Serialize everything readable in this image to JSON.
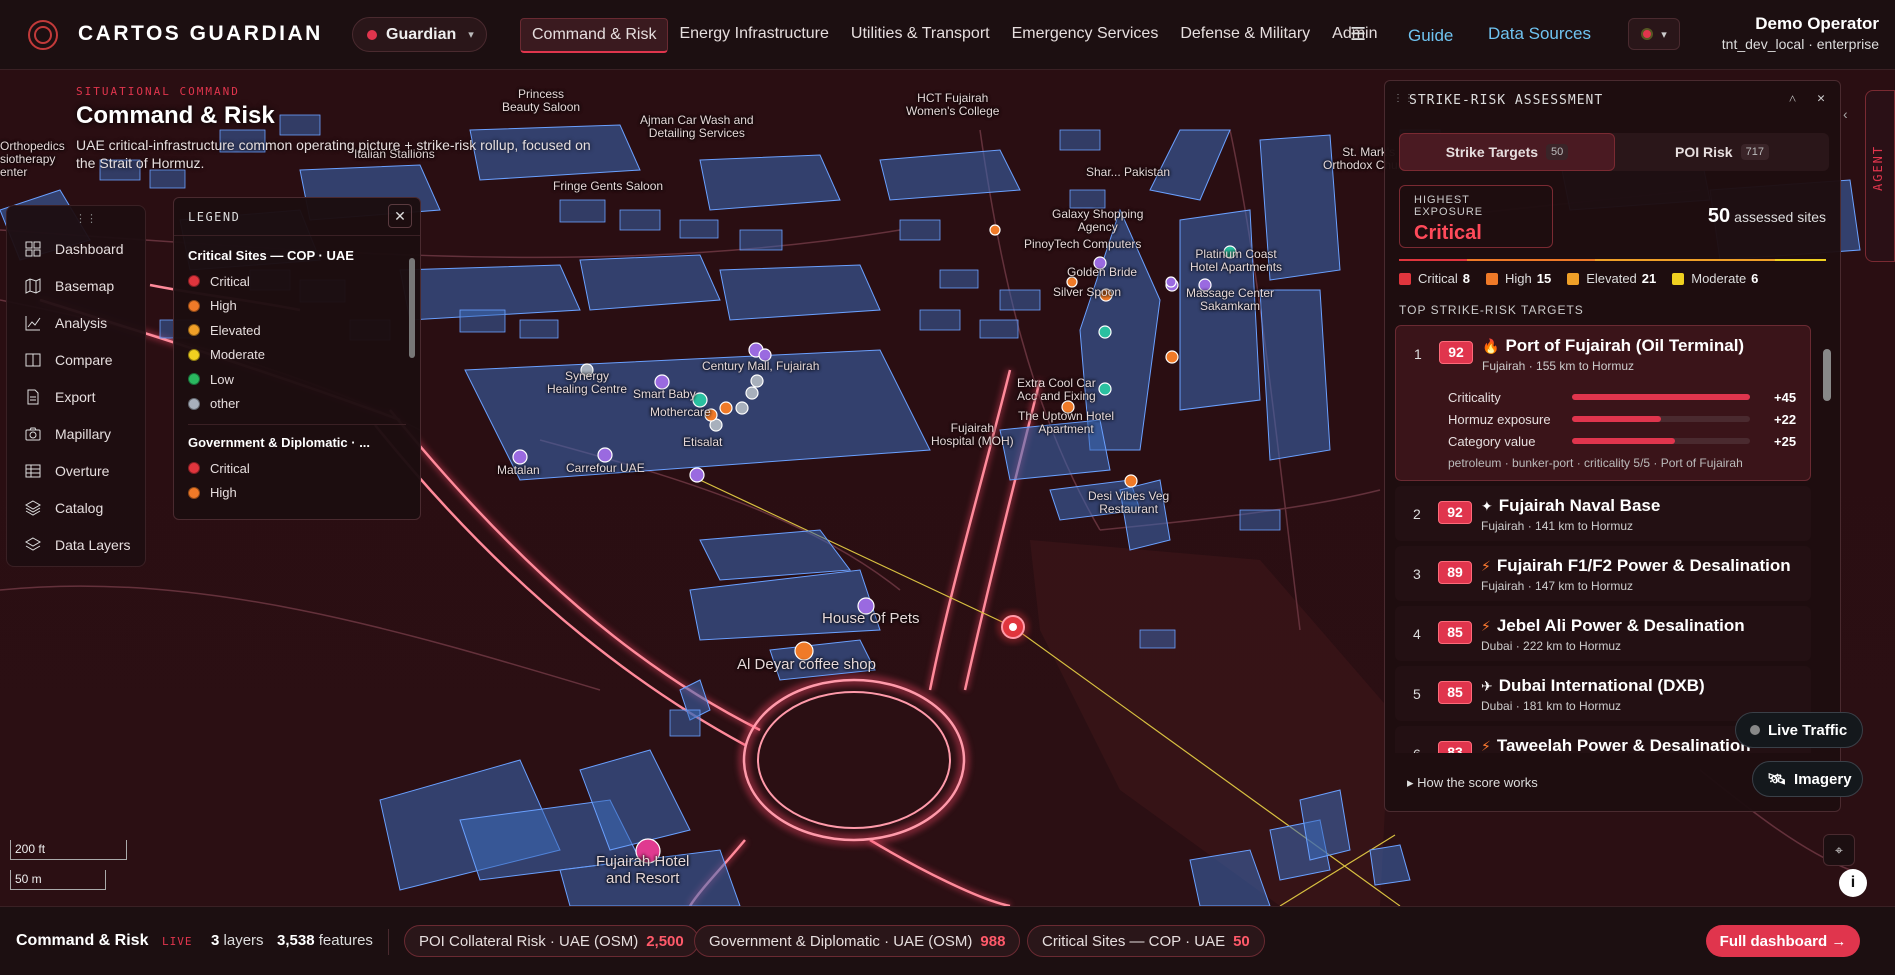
{
  "header": {
    "brand": "CARTOS GUARDIAN",
    "org": "Guardian",
    "nav": [
      "Command & Risk",
      "Energy Infrastructure",
      "Utilities & Transport",
      "Emergency Services",
      "Defense & Military",
      "Admin"
    ],
    "active_nav": "Command & Risk",
    "guide": "Guide",
    "data_sources": "Data Sources",
    "user_name": "Demo Operator",
    "user_sub": "tnt_dev_local · enterprise"
  },
  "situation": {
    "kicker": "SITUATIONAL COMMAND",
    "title": "Command & Risk",
    "description": "UAE critical-infrastructure common operating picture + strike-risk rollup, focused on the Strait of Hormuz."
  },
  "tools": [
    "Dashboard",
    "Basemap",
    "Analysis",
    "Compare",
    "Export",
    "Mapillary",
    "Overture",
    "Catalog",
    "Data Layers"
  ],
  "legend": {
    "title": "LEGEND",
    "section1": "Critical Sites — COP · UAE",
    "section1_items": [
      {
        "label": "Critical",
        "color": "#e0353d"
      },
      {
        "label": "High",
        "color": "#f07a28"
      },
      {
        "label": "Elevated",
        "color": "#f0a028"
      },
      {
        "label": "Moderate",
        "color": "#f0d020"
      },
      {
        "label": "Low",
        "color": "#2ab860"
      },
      {
        "label": "other",
        "color": "#a8b0bc"
      }
    ],
    "section2": "Government & Diplomatic · ...",
    "section2_items": [
      {
        "label": "Critical",
        "color": "#e0353d"
      },
      {
        "label": "High",
        "color": "#f07a28"
      }
    ]
  },
  "map_labels": {
    "scale_ft": "200 ft",
    "scale_m": "50 m",
    "hospital": "Fujairah\nHospital (MOH)",
    "uptown": "The Uptown Hotel\nApartment",
    "desi": "Desi Vibes Veg\nRestaurant",
    "pets": "House Of Pets",
    "coffee": "Al Deyar coffee shop",
    "resort": "Fujairah Hotel\nand Resort",
    "matalan": "Matalan",
    "carrefour": "Carrefour UAE",
    "etisalat": "Etisalat",
    "mothercare": "Mothercare",
    "smartbaby": "Smart Baby",
    "synergy": "Synergy\nHealing Centre",
    "century": "Century Mall, Fujairah",
    "extracool": "Extra Cool Car\nAcc and Fixing",
    "massage": "Massage Center\nSakamkam",
    "pinoy": "PinoyTech Computers",
    "silver": "Silver Spoon",
    "golden": "Golden Bride",
    "galaxy": "Galaxy Shopping\nAgency",
    "platinum": "Platinum Coast\nHotel Apartments",
    "fringe": "Fringe Gents Saloon",
    "hct": "HCT Fujairah\nWomen's College",
    "italian": "Italian Stallions",
    "sharq": "Shar... Pakistan",
    "stmark": "St. Mark's\nOrthodox Church",
    "ajman": "Ajman Car Wash and\nDetailing Services",
    "princess": "Princess\nBeauty Saloon",
    "ortho": "Orthopedics\nsiotherapy\nenter"
  },
  "strike_panel": {
    "title": "STRIKE-RISK ASSESSMENT",
    "tab1": "Strike Targets",
    "tab1_count": "50",
    "tab2": "POI Risk",
    "tab2_count": "717",
    "exposure_label": "HIGHEST EXPOSURE",
    "exposure_value": "Critical",
    "assessed_count": "50",
    "assessed_label": "assessed sites",
    "tiers": [
      {
        "label": "Critical",
        "count": "8",
        "color": "#e0353d"
      },
      {
        "label": "High",
        "count": "15",
        "color": "#f07a28"
      },
      {
        "label": "Elevated",
        "count": "21",
        "color": "#f0a028"
      },
      {
        "label": "Moderate",
        "count": "6",
        "color": "#f0d020"
      }
    ],
    "top_label": "TOP STRIKE-RISK TARGETS",
    "targets": [
      {
        "rank": "1",
        "score": "92",
        "name": "Port of Fujairah (Oil Terminal)",
        "icon": "flame-icon",
        "loc": "Fujairah · 155 km to Hormuz"
      },
      {
        "rank": "2",
        "score": "92",
        "name": "Fujairah Naval Base",
        "icon": "star-icon",
        "loc": "Fujairah · 141 km to Hormuz"
      },
      {
        "rank": "3",
        "score": "89",
        "name": "Fujairah F1/F2 Power & Desalination",
        "icon": "bolt-icon",
        "loc": "Fujairah · 147 km to Hormuz"
      },
      {
        "rank": "4",
        "score": "85",
        "name": "Jebel Ali Power & Desalination",
        "icon": "bolt-icon",
        "loc": "Dubai · 222 km to Hormuz"
      },
      {
        "rank": "5",
        "score": "85",
        "name": "Dubai International (DXB)",
        "icon": "plane-icon",
        "loc": "Dubai · 181 km to Hormuz"
      },
      {
        "rank": "6",
        "score": "83",
        "name": "Taweelah Power & Desalination",
        "icon": "bolt-icon",
        "loc": ""
      }
    ],
    "breakdown": [
      {
        "label": "Criticality",
        "value": "+45",
        "fraction": 1.0
      },
      {
        "label": "Hormuz exposure",
        "value": "+22",
        "fraction": 0.5
      },
      {
        "label": "Category value",
        "value": "+25",
        "fraction": 0.58
      }
    ],
    "tags": "petroleum · bunker-port · criticality 5/5 · Port of Fujairah",
    "how": "How the score works"
  },
  "controls": {
    "agent": "AGENT",
    "live_traffic": "Live Traffic",
    "imagery": "Imagery"
  },
  "bottom": {
    "title": "Command & Risk",
    "live": "LIVE",
    "layers_count": "3",
    "layers_label": "layers",
    "features_count": "3,538",
    "features_label": "features",
    "chips": [
      {
        "label": "POI Collateral Risk · UAE (OSM)",
        "count": "2,500"
      },
      {
        "label": "Government & Diplomatic · UAE (OSM)",
        "count": "988"
      },
      {
        "label": "Critical Sites — COP · UAE",
        "count": "50"
      }
    ],
    "full_dashboard": "Full dashboard →"
  }
}
